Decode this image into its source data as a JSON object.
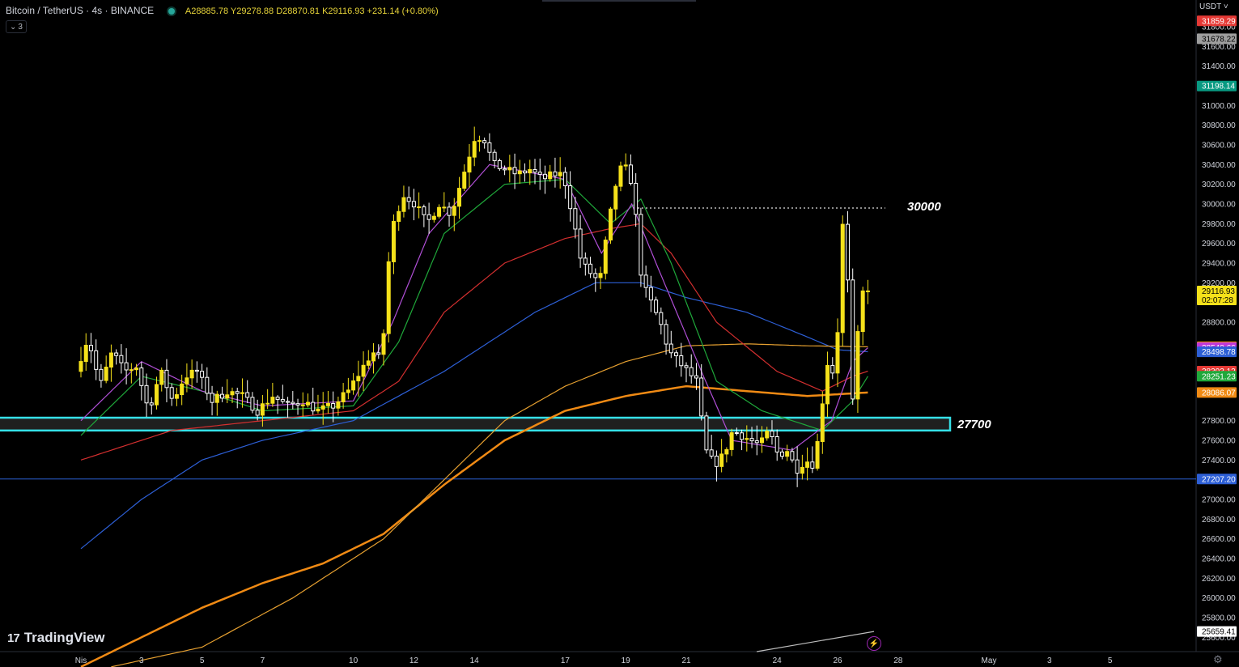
{
  "header": {
    "symbol": "Bitcoin / TetherUS · 4s · BINANCE",
    "ohlc": "A28885.78 Y29278.88 D28870.81 K29116.93 +231.14 (+0.80%)",
    "collapse_label": "3",
    "currency": "USDT"
  },
  "branding": {
    "logo_mark": "17",
    "logo_text": "TradingView"
  },
  "colors": {
    "up_candle": "#f5e11a",
    "down_candle": "#ffffff",
    "ema_fast": "#b04fd6",
    "ema_medium": "#1fa83a",
    "ema_slow": "#d32f2f",
    "ma_blue": "#2d5fd6",
    "ma_orange": "#f08a14",
    "ma_orange_thin": "#e6a030",
    "support_box": "#35e1e8",
    "h_line": "#2c63d8"
  },
  "chart_data": {
    "type": "candlestick",
    "ylim": [
      25300,
      32050
    ],
    "y_ticks": [
      "31800.00",
      "31600.00",
      "31400.00",
      "31200.00",
      "31000.00",
      "30800.00",
      "30600.00",
      "30400.00",
      "30200.00",
      "30000.00",
      "29800.00",
      "29600.00",
      "29400.00",
      "29200.00",
      "28800.00",
      "27800.00",
      "27600.00",
      "27400.00",
      "27000.00",
      "26800.00",
      "26600.00",
      "26400.00",
      "26200.00",
      "26000.00",
      "25800.00",
      "25600.00"
    ],
    "x_ticks": [
      {
        "label": "Nis",
        "day": 0
      },
      {
        "label": "3",
        "day": 2
      },
      {
        "label": "5",
        "day": 4
      },
      {
        "label": "7",
        "day": 6
      },
      {
        "label": "10",
        "day": 9
      },
      {
        "label": "12",
        "day": 11
      },
      {
        "label": "14",
        "day": 13
      },
      {
        "label": "17",
        "day": 16
      },
      {
        "label": "19",
        "day": 18
      },
      {
        "label": "21",
        "day": 20
      },
      {
        "label": "24",
        "day": 23
      },
      {
        "label": "26",
        "day": 25
      },
      {
        "label": "28",
        "day": 27
      },
      {
        "label": "May",
        "day": 30
      },
      {
        "label": "3",
        "day": 32
      },
      {
        "label": "5",
        "day": 34
      }
    ],
    "annotations": [
      {
        "label": "30000",
        "value": 30000,
        "style": "dotted"
      },
      {
        "label": "27700",
        "low": 27700,
        "high": 27830,
        "style": "box"
      }
    ],
    "horizontal_line": 27207.2,
    "price_tags": [
      {
        "label": "31859.29",
        "value": 31859.29,
        "color": "#e53935"
      },
      {
        "label": "31678.22",
        "value": 31678.22,
        "color": "#9e9e9e"
      },
      {
        "label": "31198.14",
        "value": 31198.14,
        "color": "#089981"
      },
      {
        "label": "29116.93",
        "sub": "02:07:28",
        "value": 29116.93,
        "color": "#f5e11a"
      },
      {
        "label": "28550.21",
        "value": 28550.21,
        "color": "#f08a14"
      },
      {
        "label": "28540.66",
        "value": 28540.66,
        "color": "#c038d8"
      },
      {
        "label": "28498.78",
        "value": 28498.78,
        "color": "#2d5fd6"
      },
      {
        "label": "28303.12",
        "value": 28303.12,
        "color": "#e53935"
      },
      {
        "label": "28251.23",
        "value": 28251.23,
        "color": "#1fa83a"
      },
      {
        "label": "28086.07",
        "value": 28086.07,
        "color": "#f08a14"
      },
      {
        "label": "27207.20",
        "value": 27207.2,
        "color": "#2d5fd6"
      },
      {
        "label": "25659.41",
        "value": 25659.41,
        "color": "#ffffff"
      }
    ],
    "path_keypoints": [
      [
        0,
        28300
      ],
      [
        0.4,
        28650
      ],
      [
        0.8,
        28150
      ],
      [
        1.2,
        28500
      ],
      [
        1.6,
        28300
      ],
      [
        2.0,
        28350
      ],
      [
        2.4,
        27900
      ],
      [
        2.8,
        28300
      ],
      [
        3.2,
        28000
      ],
      [
        3.6,
        28250
      ],
      [
        4.0,
        28300
      ],
      [
        4.5,
        28000
      ],
      [
        5.0,
        28100
      ],
      [
        5.5,
        28050
      ],
      [
        6.0,
        27900
      ],
      [
        6.5,
        28050
      ],
      [
        7.0,
        27950
      ],
      [
        7.5,
        28000
      ],
      [
        8.0,
        27900
      ],
      [
        8.5,
        27950
      ],
      [
        9.0,
        28100
      ],
      [
        9.4,
        28300
      ],
      [
        9.8,
        28500
      ],
      [
        10.1,
        28400
      ],
      [
        10.4,
        29700
      ],
      [
        10.8,
        30100
      ],
      [
        11.2,
        30000
      ],
      [
        11.6,
        29800
      ],
      [
        12.0,
        30000
      ],
      [
        12.4,
        29900
      ],
      [
        12.8,
        30300
      ],
      [
        13.2,
        30700
      ],
      [
        13.5,
        30650
      ],
      [
        13.8,
        30400
      ],
      [
        14.2,
        30350
      ],
      [
        14.6,
        30300
      ],
      [
        15.0,
        30350
      ],
      [
        15.4,
        30250
      ],
      [
        15.8,
        30300
      ],
      [
        16.1,
        30300
      ],
      [
        16.4,
        29900
      ],
      [
        16.7,
        29400
      ],
      [
        17.0,
        29300
      ],
      [
        17.3,
        29200
      ],
      [
        17.6,
        29800
      ],
      [
        17.9,
        30300
      ],
      [
        18.1,
        30400
      ],
      [
        18.4,
        30200
      ],
      [
        18.7,
        29200
      ],
      [
        19.0,
        29000
      ],
      [
        19.3,
        28800
      ],
      [
        19.6,
        28500
      ],
      [
        19.9,
        28400
      ],
      [
        20.2,
        28300
      ],
      [
        20.5,
        28200
      ],
      [
        20.8,
        27500
      ],
      [
        21.1,
        27350
      ],
      [
        21.4,
        27450
      ],
      [
        21.7,
        27700
      ],
      [
        22.0,
        27650
      ],
      [
        22.3,
        27600
      ],
      [
        22.6,
        27550
      ],
      [
        22.9,
        27700
      ],
      [
        23.2,
        27450
      ],
      [
        23.5,
        27500
      ],
      [
        23.8,
        27300
      ],
      [
        24.1,
        27400
      ],
      [
        24.4,
        27350
      ],
      [
        24.6,
        27800
      ],
      [
        24.8,
        28400
      ],
      [
        25.0,
        28300
      ],
      [
        25.2,
        28800
      ],
      [
        25.35,
        29900
      ],
      [
        25.5,
        29200
      ],
      [
        25.65,
        27900
      ],
      [
        25.8,
        28600
      ],
      [
        26.0,
        29116
      ]
    ],
    "ma_series": [
      {
        "name": "ma_blue",
        "points": [
          [
            0,
            26500
          ],
          [
            2,
            27000
          ],
          [
            4,
            27400
          ],
          [
            6,
            27600
          ],
          [
            9,
            27800
          ],
          [
            12,
            28300
          ],
          [
            15,
            28900
          ],
          [
            17,
            29200
          ],
          [
            18.5,
            29200
          ],
          [
            20,
            29050
          ],
          [
            22,
            28900
          ],
          [
            24,
            28650
          ],
          [
            25,
            28520
          ],
          [
            26,
            28500
          ]
        ]
      },
      {
        "name": "ma_orange",
        "points": [
          [
            0,
            25300
          ],
          [
            2,
            25600
          ],
          [
            4,
            25900
          ],
          [
            6,
            26150
          ],
          [
            8,
            26350
          ],
          [
            10,
            26650
          ],
          [
            12,
            27150
          ],
          [
            14,
            27600
          ],
          [
            16,
            27900
          ],
          [
            18,
            28050
          ],
          [
            20,
            28150
          ],
          [
            22,
            28100
          ],
          [
            24,
            28050
          ],
          [
            26,
            28086
          ]
        ]
      },
      {
        "name": "ma_orange_thin",
        "points": [
          [
            1,
            25300
          ],
          [
            4,
            25500
          ],
          [
            7,
            26000
          ],
          [
            10,
            26600
          ],
          [
            12,
            27200
          ],
          [
            14,
            27800
          ],
          [
            16,
            28150
          ],
          [
            18,
            28400
          ],
          [
            20,
            28560
          ],
          [
            22,
            28580
          ],
          [
            24,
            28560
          ],
          [
            26,
            28550
          ]
        ]
      },
      {
        "name": "ema_slow",
        "points": [
          [
            0,
            27400
          ],
          [
            3,
            27700
          ],
          [
            6,
            27800
          ],
          [
            9,
            27900
          ],
          [
            10.5,
            28200
          ],
          [
            12,
            28900
          ],
          [
            14,
            29400
          ],
          [
            16,
            29650
          ],
          [
            17.5,
            29750
          ],
          [
            18.5,
            29800
          ],
          [
            19.5,
            29500
          ],
          [
            21,
            28800
          ],
          [
            23,
            28300
          ],
          [
            24.5,
            28100
          ],
          [
            25.5,
            28250
          ],
          [
            26,
            28303
          ]
        ]
      },
      {
        "name": "ema_medium",
        "points": [
          [
            0,
            27650
          ],
          [
            2,
            28250
          ],
          [
            4,
            28100
          ],
          [
            6,
            27900
          ],
          [
            9,
            27950
          ],
          [
            10.5,
            28600
          ],
          [
            12,
            29700
          ],
          [
            14,
            30200
          ],
          [
            16,
            30250
          ],
          [
            17.5,
            29800
          ],
          [
            18.5,
            30050
          ],
          [
            19.5,
            29400
          ],
          [
            21,
            28200
          ],
          [
            22.5,
            27900
          ],
          [
            24.5,
            27700
          ],
          [
            25.5,
            28000
          ],
          [
            26,
            28251
          ]
        ]
      },
      {
        "name": "ema_fast",
        "points": [
          [
            0,
            27800
          ],
          [
            2,
            28400
          ],
          [
            4,
            28100
          ],
          [
            6,
            27950
          ],
          [
            9,
            28000
          ],
          [
            10.3,
            28800
          ],
          [
            11.5,
            29700
          ],
          [
            13.5,
            30400
          ],
          [
            16,
            30250
          ],
          [
            17.2,
            29500
          ],
          [
            18.2,
            30000
          ],
          [
            19,
            29400
          ],
          [
            20.5,
            28300
          ],
          [
            21.5,
            27600
          ],
          [
            23.5,
            27500
          ],
          [
            24.8,
            27800
          ],
          [
            25.5,
            28400
          ],
          [
            26,
            28540
          ]
        ]
      }
    ],
    "grid": false,
    "legend": "none"
  }
}
